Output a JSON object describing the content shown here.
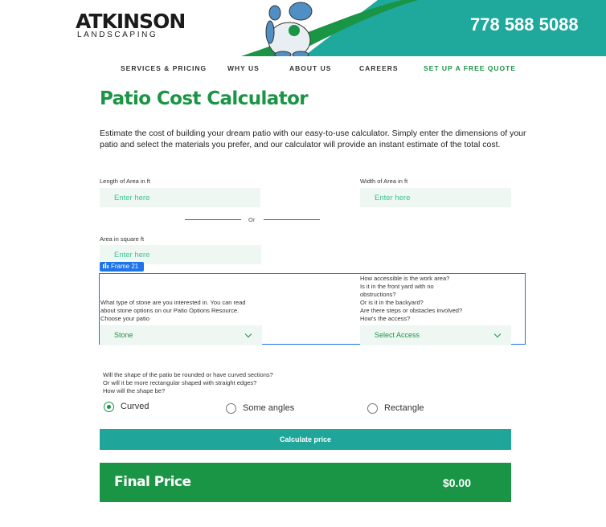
{
  "brand": {
    "logo_main": "ATKINSON",
    "logo_sub": "LANDSCAPING",
    "phone": "778 588 5088"
  },
  "nav": {
    "items": [
      "SERVICES & PRICING",
      "WHY US",
      "ABOUT US",
      "CAREERS"
    ],
    "cta": "SET UP A FREE QUOTE"
  },
  "page": {
    "title": "Patio Cost Calculator",
    "intro": "Estimate the cost of building your dream patio with our easy-to-use calculator. Simply enter the dimensions of your patio and select the materials you prefer, and our calculator will provide an instant estimate of the total cost."
  },
  "form": {
    "length_label": "Length of Area in ft",
    "width_label": "Width of Area in ft",
    "placeholder": "Enter here",
    "or": "Or",
    "area_label": "Area  in square ft",
    "frame_tag": "Frame 21",
    "stone_question": [
      "What type of stone are you interested in. You can read",
      "about stone options on our Patio Options Resource.",
      "Choose your patio"
    ],
    "stone_value": "Stone",
    "access_question": [
      "How accessible is the work area?",
      "Is it in the front yard with  no",
      "obstructions?",
      "Or is it in the backyard?",
      "Are there steps or obstacles involved?",
      "How's the access?"
    ],
    "access_value": "Select Access",
    "shape_question": [
      "Will the shape of the patio be rounded or have curved sections?",
      "Or will it be more rectangular shaped with straight edges?",
      "How will the shape be?"
    ],
    "shapes": [
      "Curved",
      "Some angles",
      "Rectangle"
    ],
    "selected_shape": "Curved",
    "calculate": "Calculate price"
  },
  "result": {
    "label": "Final Price",
    "value": "$0.00"
  },
  "colors": {
    "green": "#1a9445",
    "teal": "#20a59a",
    "selection_blue": "#1e74e8"
  }
}
